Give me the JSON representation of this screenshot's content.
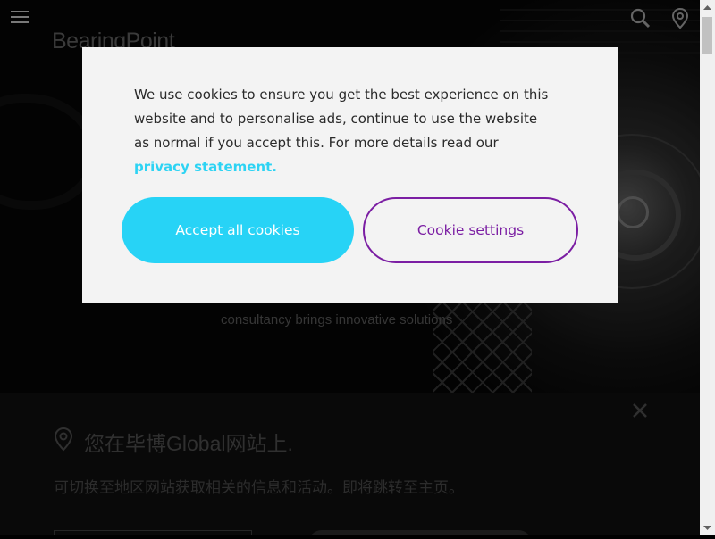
{
  "header": {
    "logo_text": "BearingPoint",
    "menu_icon": "hamburger-menu-icon",
    "search_icon": "search-icon",
    "location_icon": "location-pin-icon"
  },
  "hero": {
    "subtitle": "consultancy brings innovative solutions"
  },
  "region_banner": {
    "title": "您在毕博Global网站上.",
    "text": "可切换至地区网站获取相关的信息和活动。即将跳转至主页。",
    "pin_icon": "location-pin-icon",
    "close_icon": "close-icon"
  },
  "cookie_modal": {
    "text": "We use cookies to ensure you get the best experience on this website and to personalise ads, continue to use the website as normal if you accept this. For more details read our",
    "link_text": "privacy statement.",
    "accept_label": "Accept all cookies",
    "settings_label": "Cookie settings"
  },
  "colors": {
    "accent_cyan": "#27d3f6",
    "accent_purple": "#7b1ea3",
    "modal_bg": "#f3f3f3"
  }
}
